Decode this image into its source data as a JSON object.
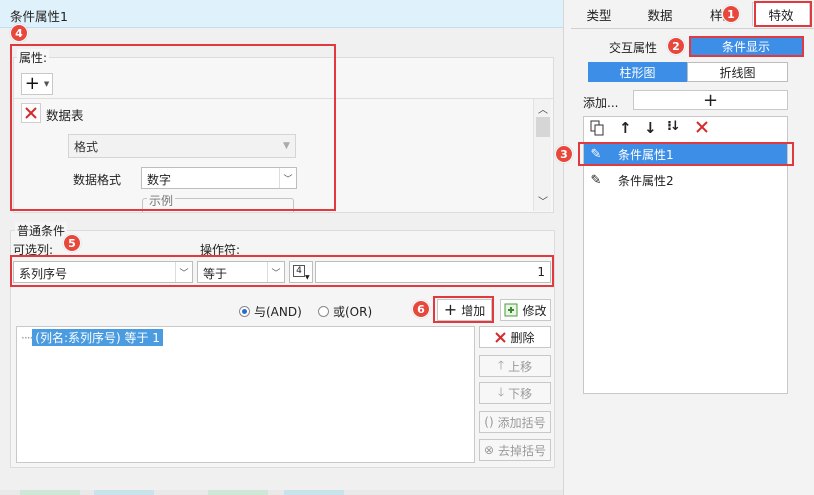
{
  "left_panel": {
    "title": "条件属性1",
    "attributes": {
      "label": "属性:",
      "add_symbol": "+",
      "item_label": "数据表",
      "format_label": "格式",
      "data_format_label": "数据格式",
      "data_format_value": "数字",
      "sample_label": "示例"
    },
    "condition": {
      "group_label": "普通条件",
      "column_label": "可选列:",
      "operator_label": "操作符:",
      "column_value": "系列序号",
      "operator_value": "等于",
      "operand_icon_text": "4",
      "value": "1",
      "and_label": "与(AND)",
      "or_label": "或(OR)",
      "selected_logic": "and",
      "add_label": "增加",
      "edit_label": "修改",
      "list_items": [
        "(列名:系列序号) 等于 1"
      ],
      "delete_label": "删除",
      "up_label": "上移",
      "down_label": "下移",
      "add_bracket_label": "添加括号",
      "remove_bracket_label": "去掉括号"
    }
  },
  "right_panel": {
    "tabs": [
      "类型",
      "数据",
      "样式",
      "特效"
    ],
    "active_tab": "特效",
    "subtabs": [
      "交互属性",
      "条件显示"
    ],
    "active_subtab": "条件显示",
    "chart_tabs": [
      "柱形图",
      "折线图"
    ],
    "active_chart_tab": "柱形图",
    "add_label": "添加...",
    "add_symbol": "+",
    "conditions": [
      "条件属性1",
      "条件属性2"
    ],
    "selected_condition": "条件属性1"
  },
  "annotations": [
    "1",
    "2",
    "3",
    "4",
    "5",
    "6"
  ],
  "colors": {
    "accent_blue": "#3d8ee6",
    "annotation_red": "#e0393e",
    "title_bar": "#dff1fb",
    "selection_text": "#4a9be0"
  }
}
